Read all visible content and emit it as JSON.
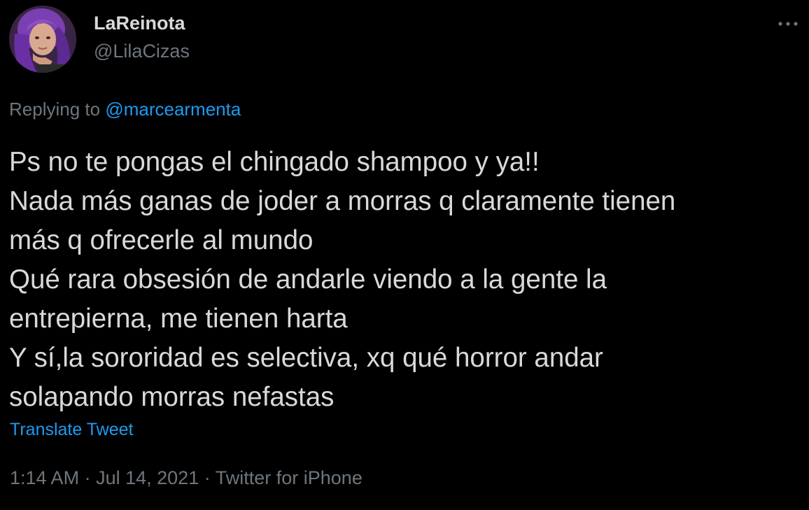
{
  "colors": {
    "background": "#000000",
    "text_primary": "#d9d9d9",
    "text_secondary": "#6e767d",
    "accent": "#1d9bf0"
  },
  "author": {
    "display_name": "LaReinota",
    "handle": "@LilaCizas",
    "avatar_icon": "avatar-photo-purple-hair"
  },
  "more_options": {
    "icon": "more-horizontal-icon"
  },
  "reply_context": {
    "prefix": "Replying to",
    "mention": "@marcearmenta"
  },
  "tweet": {
    "lines": [
      "Ps no te pongas el chingado shampoo y ya!!",
      "Nada más ganas de joder a morras q claramente tienen",
      "más q ofrecerle al mundo",
      "Qué rara obsesión de andarle viendo a la gente la",
      "entrepierna, me tienen harta",
      "Y sí,la sororidad es selectiva, xq qué horror andar",
      "solapando morras nefastas"
    ],
    "translate_label": "Translate Tweet"
  },
  "meta": {
    "time": "1:14 AM",
    "separator": "·",
    "date": "Jul 14, 2021",
    "source": "Twitter for iPhone"
  }
}
